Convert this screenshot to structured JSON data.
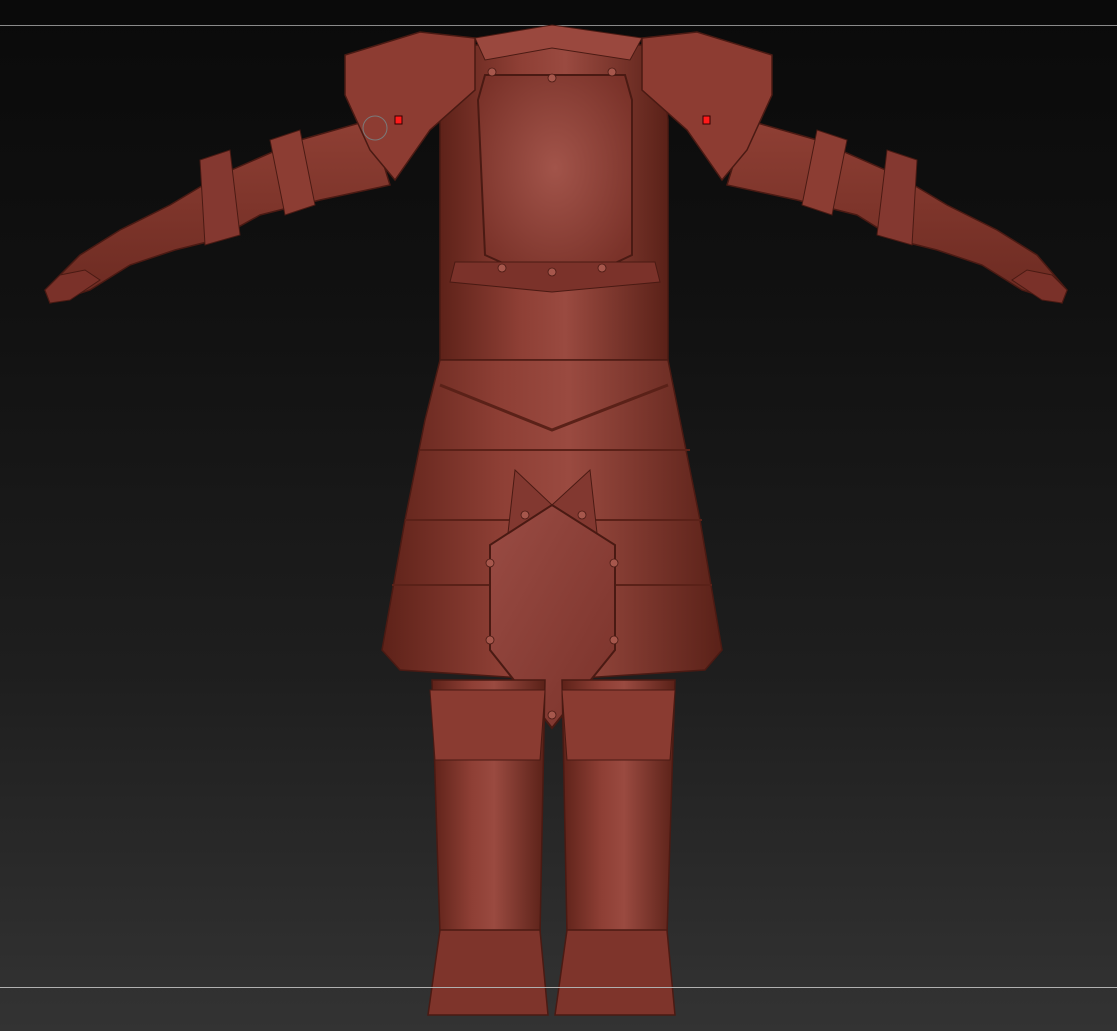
{
  "app": {
    "view": "3d-viewport",
    "model": "armored-character-t-pose",
    "material_color": "#8a3a30",
    "background_top": "#0a0a0a",
    "background_bottom": "#333333",
    "symmetry_marker_color": "#ff1a1a"
  }
}
